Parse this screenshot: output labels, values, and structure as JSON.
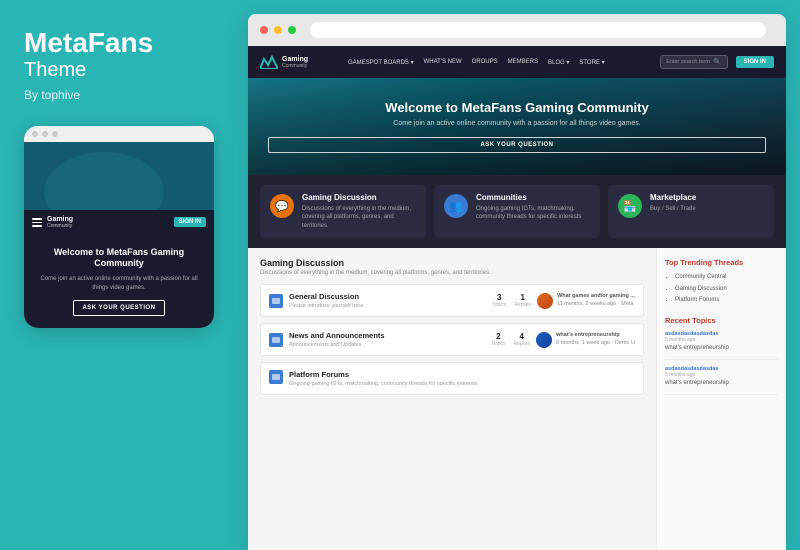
{
  "left_panel": {
    "brand": {
      "title": "MetaFans",
      "subtitle": "Theme",
      "author": "By tophive"
    },
    "mobile": {
      "welcome": "Welcome to MetaFans Gaming Community",
      "tagline": "Come join an active online community with a passion for all things video games.",
      "ask_btn": "ASK YOUR QUESTION",
      "signin_label": "SIGN IN"
    }
  },
  "browser": {
    "dots": [
      "red",
      "yellow",
      "green"
    ]
  },
  "site": {
    "logo": {
      "main": "Gaming",
      "sub": "Community"
    },
    "nav": [
      {
        "label": "GAMESPOT BOARDS",
        "has_caret": true
      },
      {
        "label": "WHAT'S NEW"
      },
      {
        "label": "GROUPS"
      },
      {
        "label": "MEMBERS"
      },
      {
        "label": "BLOG",
        "has_caret": true
      },
      {
        "label": "STORE",
        "has_caret": true
      }
    ],
    "search_placeholder": "Enter search term",
    "signin_label": "SIGN IN",
    "hero": {
      "title": "Welcome to MetaFans Gaming Community",
      "subtitle": "Come join an active online community with a passion for all things video games.",
      "cta": "ASK YOUR QUESTION"
    },
    "categories": [
      {
        "icon": "💬",
        "icon_style": "orange",
        "title": "Gaming Discussion",
        "desc": "Discussions of everything in the medium, covering all platforms, genres, and territories."
      },
      {
        "icon": "👥",
        "icon_style": "blue",
        "title": "Communities",
        "desc": "Ongoing gaming IGTs, matchmaking, community threads for specific interests"
      },
      {
        "icon": "🏪",
        "icon_style": "green",
        "title": "Marketplace",
        "desc": "Buy / Sell / Trade"
      }
    ],
    "main_section": {
      "title": "Gaming Discussion",
      "desc": "Discussions of everything in the medium, covering all platforms, genres, and territories.",
      "forums": [
        {
          "name": "General Discussion",
          "tagline": "Please introduce yourself here",
          "topics": "3",
          "replies": "1",
          "last_post": "What games and/or gaming ...",
          "last_meta": "11 months, 2 weeks ago · Meta"
        },
        {
          "name": "News and Announcements",
          "tagline": "Announcements and Updates",
          "topics": "2",
          "replies": "4",
          "last_post": "what's entrepreneurship",
          "last_meta": "6 months, 1 week ago · Demo U"
        },
        {
          "name": "Platform Forums",
          "tagline": "Ongoing gaming IGTs, matchmaking, community threads for specific interests"
        }
      ]
    },
    "sidebar": {
      "trending_title": "Top Trending Threads",
      "trending_items": [
        "Community Central",
        "Gaming Discussion",
        "Platform Forums"
      ],
      "recent_title": "Recent Topics",
      "recent_items": [
        {
          "user": "asdasdasdasdasdas",
          "meta": "5 months ago",
          "text": "what's entrepreneurship"
        }
      ]
    }
  }
}
